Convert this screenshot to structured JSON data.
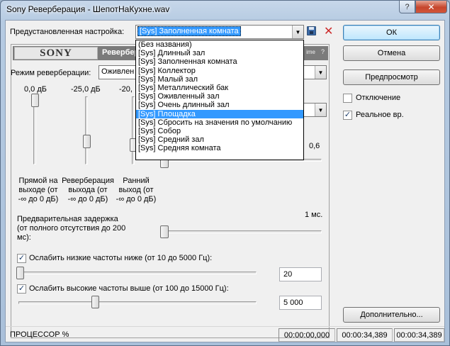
{
  "window": {
    "title": "Sony Реверберация - ШепотНаКухне.wav",
    "help_glyph": "?",
    "close_glyph": "✕"
  },
  "preset": {
    "label": "Предустановленная настройка:",
    "selected": "[Sys] Заполненная комната",
    "options": [
      "(Без названия)",
      "[Sys] Длинный зал",
      "[Sys] Заполненная комната",
      "[Sys] Коллектор",
      "[Sys] Малый зал",
      "[Sys] Металлический бак",
      "[Sys] Оживленный зал",
      "[Sys] Очень длинный зал",
      "[Sys] Площадка",
      "[Sys] Сбросить на значения по умолчанию",
      "[Sys] Собор",
      "[Sys] Средний зал",
      "[Sys] Средняя комната"
    ],
    "highlighted_index": 8,
    "delete_glyph": "✕"
  },
  "brand": {
    "logo_text": "SONY",
    "name_partial": "Ревербера",
    "right_partial": "ime",
    "help_glyph": "?"
  },
  "reverb_mode": {
    "label": "Режим реверберации:",
    "value_partial": "Оживлен"
  },
  "sliders": {
    "dry_out": {
      "value": "0,0 дБ",
      "label_lines": [
        "Прямой на",
        "выходе (от",
        "-∞ до 0 дБ)"
      ]
    },
    "reverb_out": {
      "value": "-25,0 дБ",
      "label_lines": [
        "Реверберация",
        "выхода (от",
        "-∞ до 0 дБ)"
      ]
    },
    "early_out": {
      "value": "-20,",
      "label_lines": [
        "Ранний",
        "выход (от",
        "-∞ до 0 дБ)"
      ]
    },
    "decay_value": "0,6"
  },
  "predelay": {
    "label_lines": [
      "Предварительная задержка",
      "(от полного отсутствия до 200",
      "мс):"
    ],
    "value": "1 мс."
  },
  "low_cut": {
    "checked": true,
    "label": "Ослабить низкие частоты ниже (от 10 до 5000 Гц):",
    "value": "20"
  },
  "high_cut": {
    "checked": true,
    "label": "Ослабить высокие частоты выше (от 100 до 15000 Гц):",
    "value": "5 000"
  },
  "buttons": {
    "ok": "ОК",
    "cancel": "Отмена",
    "preview": "Предпросмотр",
    "advanced": "Дополнительно..."
  },
  "options": {
    "bypass": {
      "label": "Отключение",
      "checked": false
    },
    "realtime": {
      "label": "Реальное вр.",
      "checked": true
    }
  },
  "status": {
    "cpu_label": "ПРОЦЕССОР %",
    "time1": "00:00:00,000",
    "time2": "00:00:34,389",
    "time3": "00:00:34,389"
  },
  "glyphs": {
    "dropdown_arrow": "▼",
    "check": "✓"
  }
}
